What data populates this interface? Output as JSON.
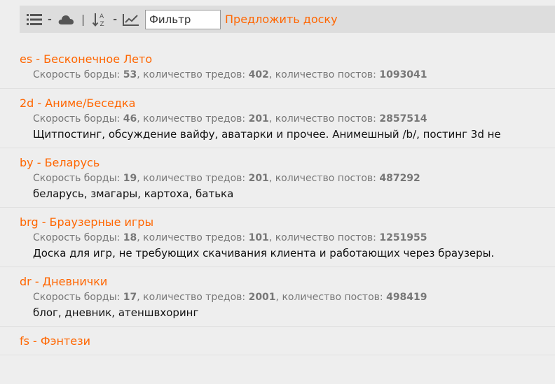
{
  "toolbar": {
    "icons": {
      "list": "list-icon",
      "cloud": "cloud-icon",
      "sort": "sort-az-icon",
      "chart": "line-chart-icon"
    },
    "separators": [
      "-",
      "|",
      "-"
    ],
    "filter_placeholder": "Фильтр",
    "suggest_label": "Предложить доску"
  },
  "stats_labels": {
    "speed": "Скорость борды: ",
    "threads": ", количество тредов: ",
    "posts": ", количество постов: "
  },
  "boards": [
    {
      "title": "es - Бесконечное Лето",
      "speed": "53",
      "threads": "402",
      "posts": "1093041",
      "desc": ""
    },
    {
      "title": "2d - Аниме/Беседка",
      "speed": "46",
      "threads": "201",
      "posts": "2857514",
      "desc": "Щитпостинг, обсуждение вайфу, аватарки и прочее. Анимешный /b/, постинг 3d не"
    },
    {
      "title": "by - Беларусь",
      "speed": "19",
      "threads": "201",
      "posts": "487292",
      "desc": "беларусь, змагары, картоха, батька"
    },
    {
      "title": "brg - Браузерные игры",
      "speed": "18",
      "threads": "101",
      "posts": "1251955",
      "desc": "Доска для игр, не требующих скачивания клиента и работающих через браузеры."
    },
    {
      "title": "dr - Дневнички",
      "speed": "17",
      "threads": "2001",
      "posts": "498419",
      "desc": "блог, дневник, атеншвхоринг"
    },
    {
      "title": "fs - Фэнтези",
      "speed": "",
      "threads": "",
      "posts": "",
      "desc": ""
    }
  ],
  "colors": {
    "accent": "#ff6600",
    "toolbar_bg": "#dddddd",
    "page_bg": "#eeeeee",
    "stats_text": "#777777"
  }
}
